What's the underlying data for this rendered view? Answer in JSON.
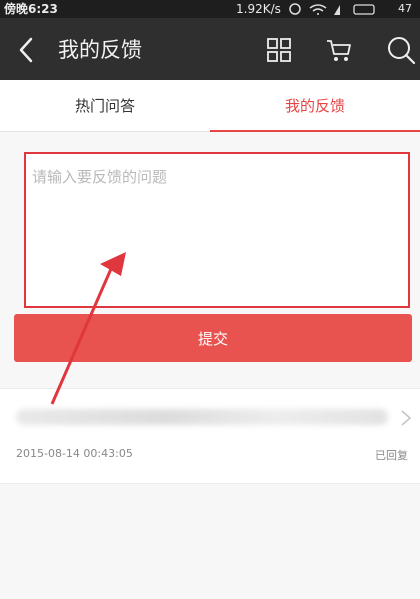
{
  "status_bar": {
    "time": "傍晚6:23",
    "speed": "1.92K/s",
    "battery": "47"
  },
  "header": {
    "title": "我的反馈",
    "icons": [
      "back-icon",
      "grid-icon",
      "cart-icon",
      "search-icon"
    ]
  },
  "tabs": [
    {
      "label": "热门问答",
      "active": false
    },
    {
      "label": "我的反馈",
      "active": true
    }
  ],
  "feedback_form": {
    "value": "",
    "placeholder": "请输入要反馈的问题",
    "submit_label": "提交"
  },
  "feedback_items": [
    {
      "date": "2015-08-14 00:43:05",
      "status": "已回复"
    }
  ],
  "colors": {
    "accent": "#e8534f",
    "header_bg": "#2f2f2f",
    "highlight_box": "#e0363d"
  }
}
